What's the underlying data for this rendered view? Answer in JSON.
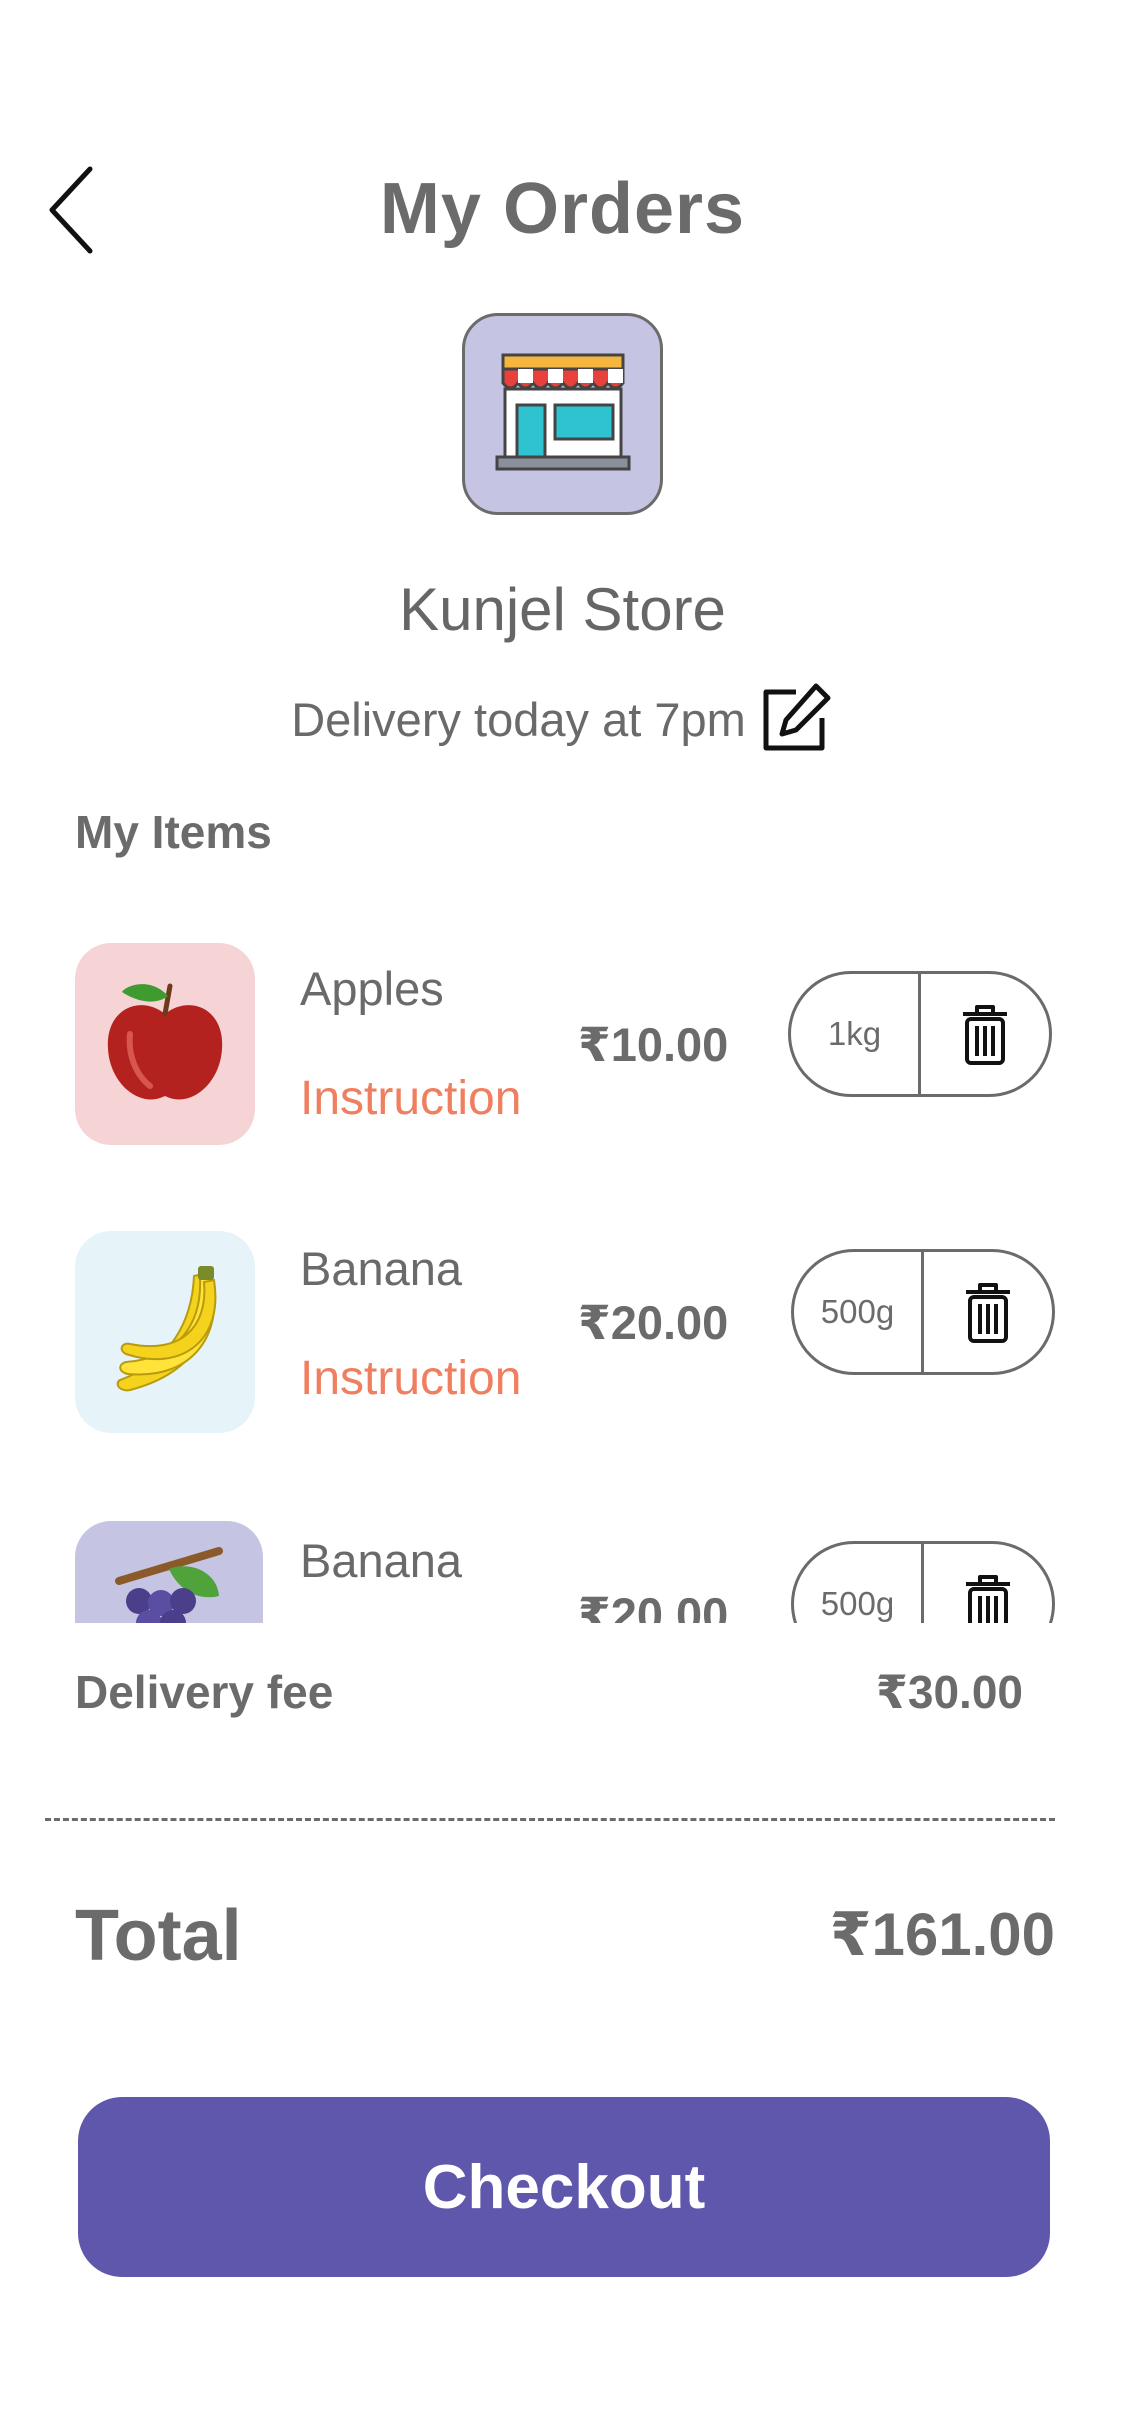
{
  "header": {
    "title": "My Orders",
    "back_icon": "chevron-left-icon"
  },
  "store": {
    "name": "Kunjel Store",
    "icon": "store-icon",
    "logo_bg": "#c6c4e3",
    "delivery_text": "Delivery today at 7pm",
    "edit_icon": "edit-icon"
  },
  "items_section": {
    "title": "My Items"
  },
  "items": [
    {
      "name": "Apples",
      "instruction": "Instruction",
      "price": "₹10.00",
      "quantity": "1kg",
      "thumb_icon": "apple-icon",
      "thumb_bg": "#f6d4d6",
      "delete_icon": "trash-icon"
    },
    {
      "name": "Banana",
      "instruction": "Instruction",
      "price": "₹20.00",
      "quantity": "500g",
      "thumb_icon": "banana-icon",
      "thumb_bg": "#e6f3f8",
      "delete_icon": "trash-icon"
    },
    {
      "name": "Banana",
      "instruction": "",
      "price": "₹20.00",
      "quantity": "500g",
      "thumb_icon": "grapes-icon",
      "thumb_bg": "#c6c4e3",
      "delete_icon": "trash-icon"
    }
  ],
  "delivery_fee": {
    "label": "Delivery fee",
    "value": "₹30.00"
  },
  "total": {
    "label": "Total",
    "value": "₹161.00"
  },
  "checkout": {
    "label": "Checkout",
    "color": "#5e57ac"
  },
  "colors": {
    "accent": "#ef7f5f",
    "text": "#6b6b6b"
  }
}
